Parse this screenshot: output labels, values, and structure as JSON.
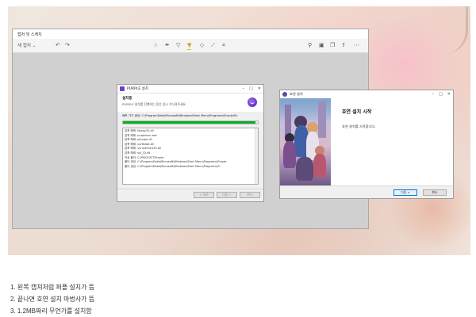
{
  "caption": "",
  "snipping_tool": {
    "title": "캡처 및 스케치",
    "new_label": "새 캡처"
  },
  "purple_installer": {
    "title": "PURPLE 설치",
    "header_title": "설치중",
    "header_subtitle": "PURPLE 설치를 진행하는 동안 잠시 기다려주세요.",
    "extract_line": "배포 가기 생성: C:\\ProgramData\\Microsoft\\Windows\\Start Menu\\Programs\\Purple\\Pu",
    "progress": 0.98,
    "log_lines": [
      "압축 해제: libeay32.dll",
      "압축 해제: purplesvc.exe",
      "압축 해제: plluupe.dll",
      "압축 해제: ucrtbase.dll",
      "압축 해제: vcruntime140.dll",
      "압축 해제: ssl_32.dll",
      "자상 폴더: C:\\PNCSOFT\\Purple",
      "폴더 생성: C:\\ProgramData\\Microsoft\\Windows\\Start Menu\\Programs\\Purple",
      "폴더 생성: C:\\ProgramData\\Microsoft\\Windows\\Start Menu\\Programs\\P..."
    ],
    "buttons": {
      "back": "< 뒤로",
      "next": "다음 >",
      "cancel": "취소"
    }
  },
  "hoyeon_installer": {
    "title": "호연 설치",
    "heading": "호연 설치 시작",
    "description": "호연 설치를 시작합니다.",
    "buttons": {
      "next": "다음 >",
      "cancel": "취소"
    }
  },
  "notes": [
    "1. 왼쪽 캡쳐처럼 퍼플 설치가 뜸",
    "2. 끝나면 호연 설치 마법사가 뜸",
    "3. 1.2MB짜리 무언가를 설치함"
  ]
}
